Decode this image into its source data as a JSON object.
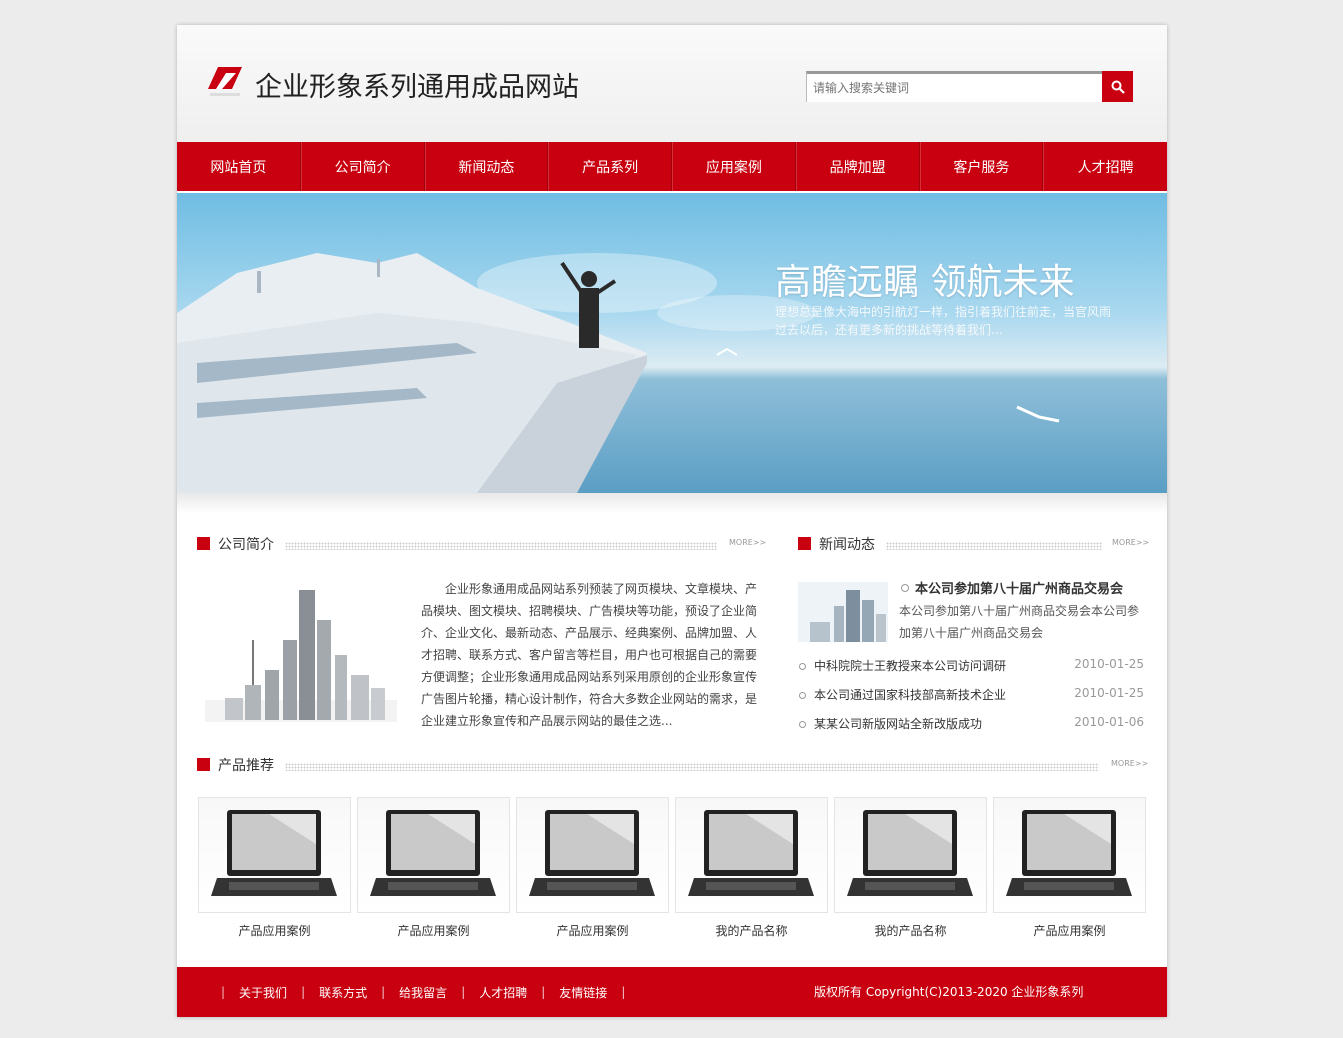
{
  "header": {
    "site_title": "企业形象系列通用成品网站",
    "search_placeholder": "请输入搜索关键词"
  },
  "nav": [
    {
      "label": "网站首页"
    },
    {
      "label": "公司简介"
    },
    {
      "label": "新闻动态"
    },
    {
      "label": "产品系列"
    },
    {
      "label": "应用案例"
    },
    {
      "label": "品牌加盟"
    },
    {
      "label": "客户服务"
    },
    {
      "label": "人才招聘"
    }
  ],
  "banner": {
    "title": "高瞻远瞩 领航未来",
    "subtitle": "理想总是像大海中的引航灯一样，指引着我们往前走，当官风雨过去以后，还有更多新的挑战等待着我们…"
  },
  "about": {
    "title": "公司简介",
    "more": "MORE>>",
    "text": "企业形象通用成品网站系列预装了网页模块、文章模块、产品模块、图文模块、招聘模块、广告模块等功能，预设了企业简介、企业文化、最新动态、产品展示、经典案例、品牌加盟、人才招聘、联系方式、客户留言等栏目，用户也可根据自己的需要方便调整；企业形象通用成品网站系列采用原创的企业形象宣传广告图片轮播，精心设计制作，符合大多数企业网站的需求，是企业建立形象宣传和产品展示网站的最佳之选..."
  },
  "news": {
    "title": "新闻动态",
    "more": "MORE>>",
    "featured_title": "本公司参加第八十届广州商品交易会",
    "featured_desc": "本公司参加第八十届广州商品交易会本公司参加第八十届广州商品交易会",
    "items": [
      {
        "text": "中科院院士王教授来本公司访问调研",
        "date": "2010-01-25"
      },
      {
        "text": "本公司通过国家科技部高新技术企业",
        "date": "2010-01-25"
      },
      {
        "text": "某某公司新版网站全新改版成功",
        "date": "2010-01-06"
      }
    ]
  },
  "products": {
    "title": "产品推荐",
    "more": "MORE>>",
    "items": [
      {
        "name": "产品应用案例"
      },
      {
        "name": "产品应用案例"
      },
      {
        "name": "产品应用案例"
      },
      {
        "name": "我的产品名称"
      },
      {
        "name": "我的产品名称"
      },
      {
        "name": "产品应用案例"
      }
    ]
  },
  "footer": {
    "sep": "|",
    "links": [
      {
        "label": "关于我们"
      },
      {
        "label": "联系方式"
      },
      {
        "label": "给我留言"
      },
      {
        "label": "人才招聘"
      },
      {
        "label": "友情链接"
      }
    ],
    "copyright": "版权所有 Copyright(C)2013-2020 企业形象系列"
  },
  "colors": {
    "accent": "#c8000f",
    "background": "#ececec"
  }
}
